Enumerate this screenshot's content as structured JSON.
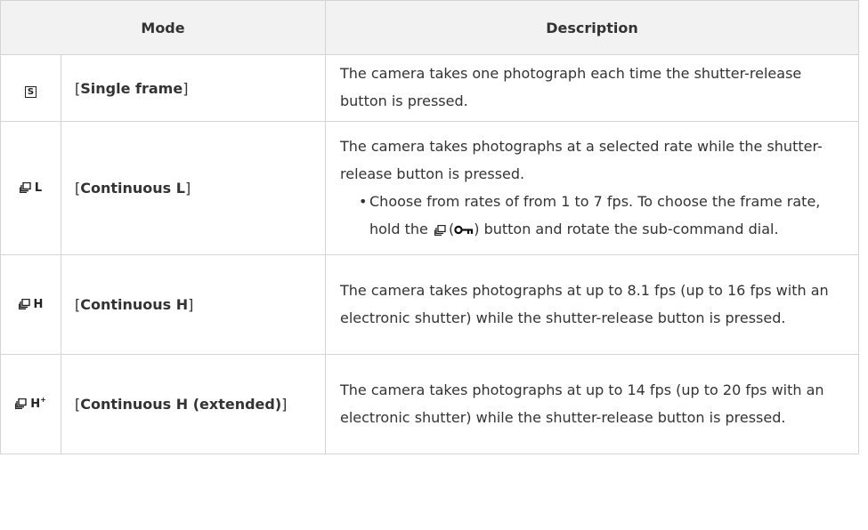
{
  "table": {
    "header": {
      "mode": "Mode",
      "description": "Description"
    },
    "rows": [
      {
        "icon": "single-frame-icon",
        "icon_letter": "S",
        "open_bracket": "[",
        "setting": "Single frame",
        "close_bracket": "]",
        "description": "The camera takes one photograph each time the shutter-release button is pressed."
      },
      {
        "icon": "continuous-low-icon",
        "icon_letter": "L",
        "open_bracket": "[",
        "setting": "Continuous L",
        "close_bracket": "]",
        "description": "The camera takes photographs at a selected rate while the shutter-release button is pressed.",
        "bullet_marker": "•",
        "bullet_before_icon": "Choose from rates of from 1 to 7 fps. To choose the frame rate, hold the",
        "bullet_paren_open": "(",
        "bullet_paren_close": ")",
        "bullet_after_icon": "button and rotate the sub-command dial.",
        "inline_icons": [
          "release-mode-icon",
          "key-lock-icon"
        ]
      },
      {
        "icon": "continuous-high-icon",
        "icon_letter": "H",
        "open_bracket": "[",
        "setting": "Continuous H",
        "close_bracket": "]",
        "description": "The camera takes photographs at up to 8.1 fps (up to 16 fps with an electronic shutter) while the shutter-release button is pressed."
      },
      {
        "icon": "continuous-high-extended-icon",
        "icon_letter": "H",
        "icon_superscript": "+",
        "open_bracket": "[",
        "setting": "Continuous H (extended)",
        "close_bracket": "]",
        "description": "The camera takes photographs at up to 14 fps (up to 20 fps with an electronic shutter) while the shutter-release button is pressed."
      }
    ]
  },
  "colors": {
    "header_bg": "#f2f2f2",
    "border": "#d4d4d4",
    "text": "#333333"
  }
}
